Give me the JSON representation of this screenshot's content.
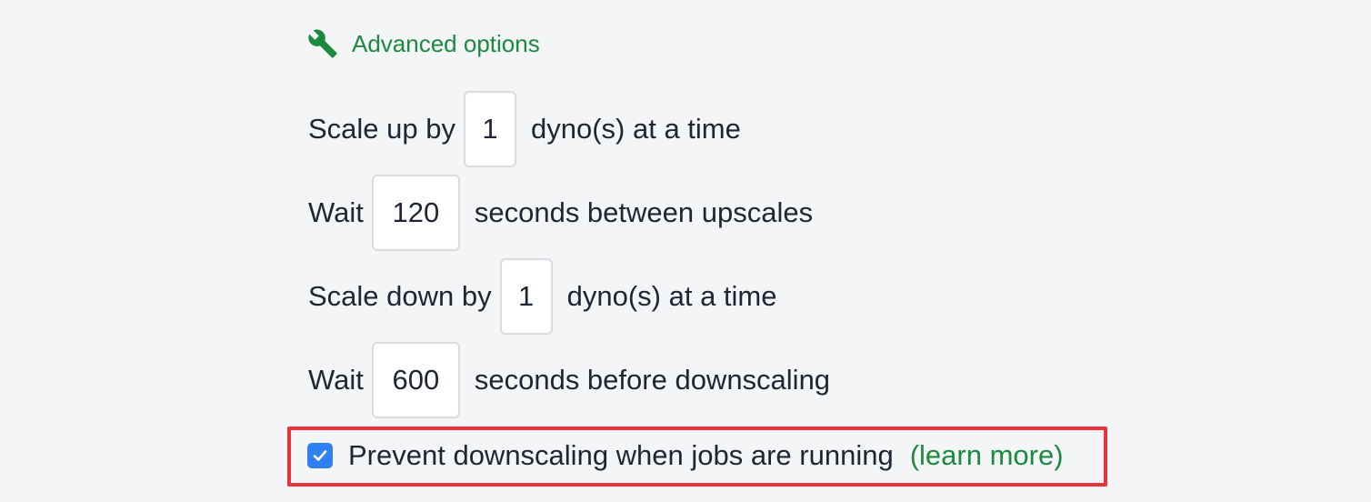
{
  "advanced": {
    "header_label": "Advanced options",
    "icon": "wrench-icon",
    "accent_color": "#1b8a3e"
  },
  "settings": {
    "scale_up": {
      "prefix": "Scale up by",
      "value": "1",
      "suffix": "dyno(s) at a time"
    },
    "upscale_wait": {
      "prefix": "Wait",
      "value": "120",
      "suffix": "seconds between upscales"
    },
    "scale_down": {
      "prefix": "Scale down by",
      "value": "1",
      "suffix": "dyno(s) at a time"
    },
    "downscale_wait": {
      "prefix": "Wait",
      "value": "600",
      "suffix": "seconds before downscaling"
    }
  },
  "prevent_downscale": {
    "checked": true,
    "label": "Prevent downscaling when jobs are running",
    "link_label": "(learn more)",
    "highlight_color": "#e8333d",
    "checkbox_color": "#2f7ff5"
  }
}
